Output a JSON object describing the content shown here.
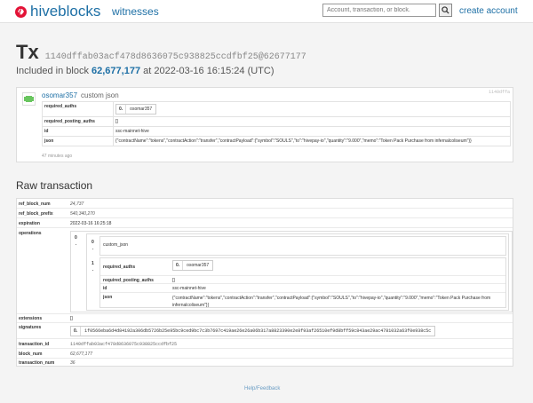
{
  "nav": {
    "brand": "hiveblocks",
    "witnesses": "witnesses",
    "search_placeholder": "Account, transaction, or block.",
    "create_account": "create account"
  },
  "tx": {
    "label": "Tx",
    "hash_display": "1140dffab03acf478d8636075c938825ccdfbf25@62677177",
    "included_prefix": "Included in block",
    "block_num": "62,677,177",
    "included_at": "at 2022-03-16 16:15:24 (UTC)"
  },
  "operation": {
    "user": "osomar357",
    "type": "custom json",
    "short_hash": "1140dffa",
    "rows": {
      "required_auths_key": "required_auths",
      "required_auths_index": "0.",
      "required_auths_value": "osomar357",
      "required_posting_auths_key": "required_posting_auths",
      "required_posting_auths_value": "[]",
      "id_key": "id",
      "id_value": "ssc-mainnet-hive",
      "json_key": "json",
      "json_value": "{\"contractName\":\"tokens\",\"contractAction\":\"transfer\",\"contractPayload\":{\"symbol\":\"SOULS\",\"to\":\"hivepay-io\",\"quantity\":\"9.000\",\"memo\":\"Token Pack Purchase from infernalcoliseum\"}}"
    },
    "time_ago": "47 minutes ago"
  },
  "raw": {
    "title": "Raw transaction",
    "ref_block_num_key": "ref_block_num",
    "ref_block_num": "24,737",
    "ref_block_prefix_key": "ref_block_prefix",
    "ref_block_prefix": "540,340,270",
    "expiration_key": "expiration",
    "expiration": "2022-03-16 16:25:18",
    "operations_key": "operations",
    "op_outer_index": "0",
    "op_index_0": "0",
    "op_name": "custom_json",
    "op_index_1": "1",
    "required_auths_key": "required_auths",
    "required_auths_index": "0.",
    "required_auths_value": "osomar357",
    "required_posting_auths_key": "required_posting_auths",
    "required_posting_auths_value": "[]",
    "id_key": "id",
    "id_value": "ssc-mainnet-hive",
    "json_key": "json",
    "json_value": "{\"contractName\":\"tokens\",\"contractAction\":\"transfer\",\"contractPayload\":{\"symbol\":\"SOULS\",\"to\":\"hivepay-io\",\"quantity\":\"9.000\",\"memo\":\"Token Pack Purchase from infernalcoliseum\"}}",
    "extensions_key": "extensions",
    "extensions": "[]",
    "signatures_key": "signatures",
    "signature_index": "0.",
    "signature": "1f0566eba6d4d84192a306db5726b25e95bc9ced9bc7c3b7697c419ae26e26a06b317a8823390e2e8f93af26510ef9d8bff59c843ae29ac4781032a63f0e938c5c",
    "transaction_id_key": "transaction_id",
    "transaction_id": "1140dffab03acf478d8636075c938825ccdfbf25",
    "block_num_key": "block_num",
    "block_num": "62,677,177",
    "transaction_num_key": "transaction_num",
    "transaction_num": "36"
  },
  "footer": {
    "help": "Help/Feedback"
  }
}
